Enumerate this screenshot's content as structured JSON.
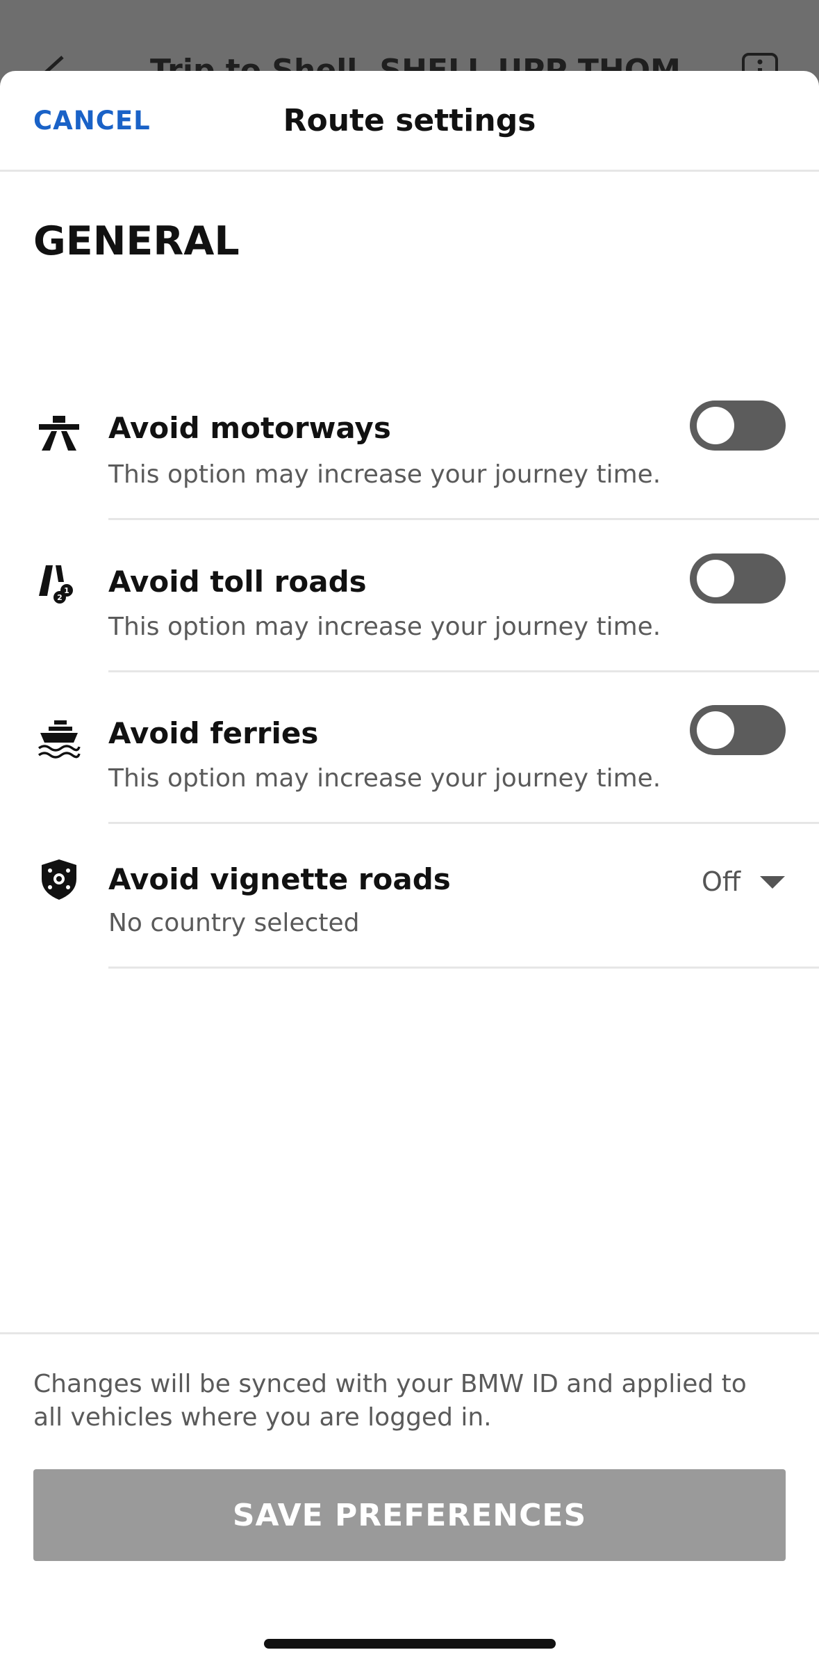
{
  "background": {
    "title": "Trip to Shell, SHELL UPP THOMSON"
  },
  "header": {
    "cancel_label": "CANCEL",
    "title": "Route settings"
  },
  "section": {
    "title": "GENERAL"
  },
  "options": [
    {
      "icon": "motorway-icon",
      "label": "Avoid motorways",
      "description": "This option may increase your journey time.",
      "enabled": false
    },
    {
      "icon": "toll-road-icon",
      "label": "Avoid toll roads",
      "description": "This option may increase your journey time.",
      "enabled": false
    },
    {
      "icon": "ferry-icon",
      "label": "Avoid ferries",
      "description": "This option may increase your journey time.",
      "enabled": false
    },
    {
      "icon": "vignette-shield-icon",
      "label": "Avoid vignette roads",
      "description": "No country selected",
      "selected_value": "Off"
    }
  ],
  "footer": {
    "note": "Changes will be synced with your BMW ID and applied to all vehicles where you are logged in.",
    "save_label": "SAVE PREFERENCES"
  },
  "colors": {
    "accent": "#1a62c7",
    "toggle_off": "#5c5c5c",
    "button_disabled": "#9a9a9a"
  }
}
